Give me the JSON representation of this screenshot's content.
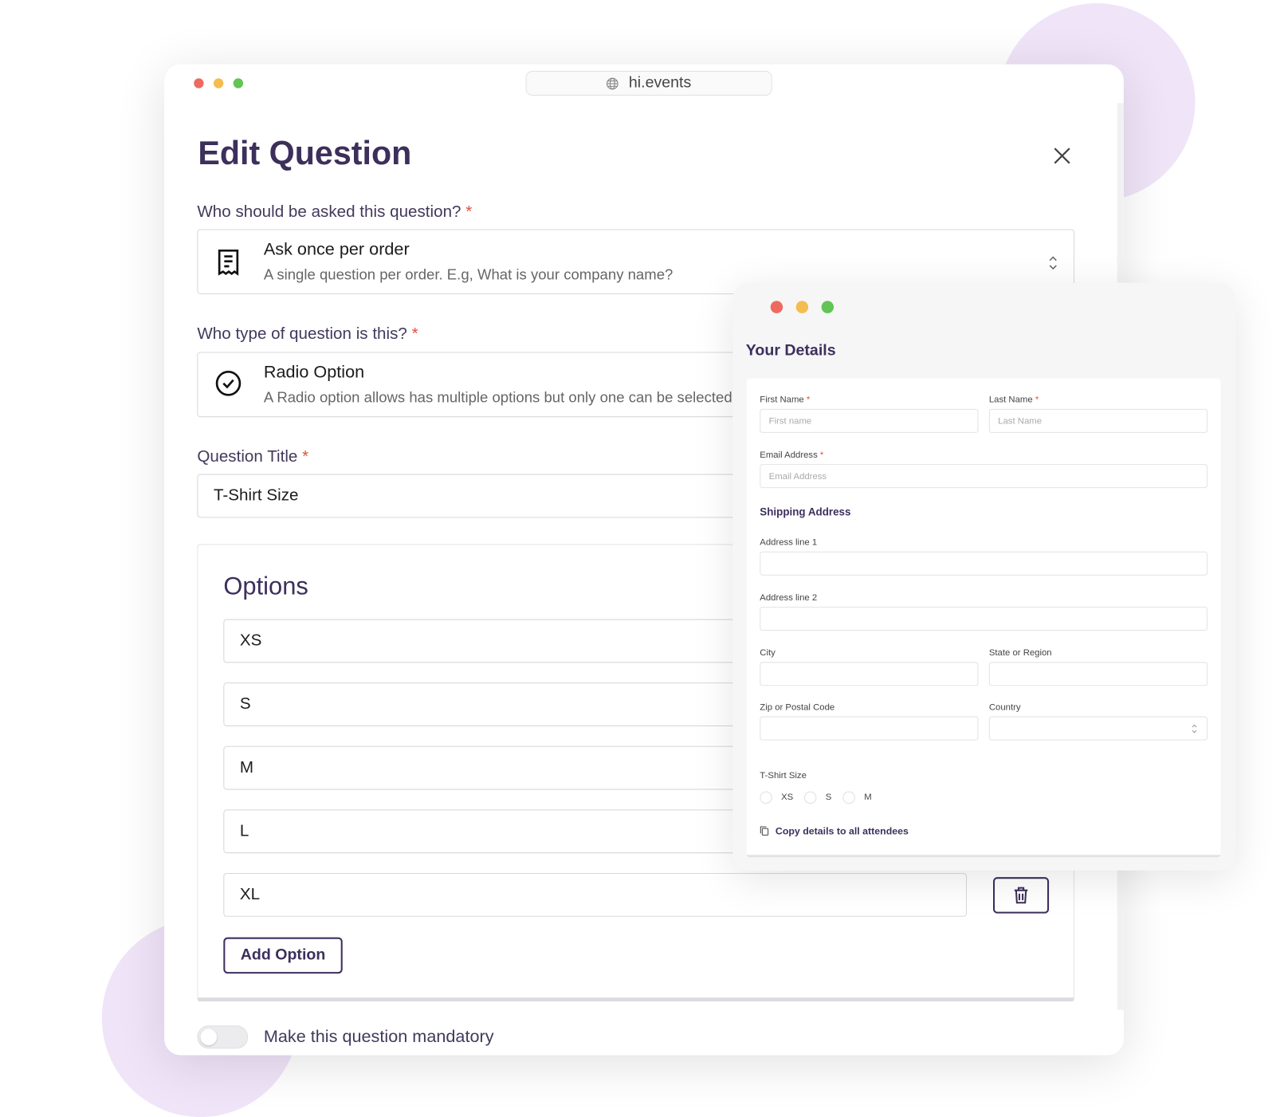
{
  "browser": {
    "url": "hi.events"
  },
  "editor": {
    "title": "Edit Question",
    "audience": {
      "label": "Who should be asked this question?",
      "required": "*",
      "selected_title": "Ask once per order",
      "selected_desc": "A single question per order. E.g, What is your company name?",
      "icon": "receipt-icon"
    },
    "type": {
      "label": "Who type of question is this?",
      "required": "*",
      "selected_title": "Radio Option",
      "selected_desc": "A Radio option allows has multiple options but only one can be selected.",
      "icon": "check-circle-icon"
    },
    "question_title": {
      "label": "Question Title",
      "required": "*",
      "value": "T-Shirt Size"
    },
    "options": {
      "heading": "Options",
      "items": [
        "XS",
        "S",
        "M",
        "L",
        "XL"
      ],
      "add_label": "Add Option"
    },
    "mandatory": {
      "label": "Make this question mandatory",
      "on": false
    }
  },
  "preview": {
    "title": "Your Details",
    "first_name": {
      "label": "First Name",
      "required": "*",
      "placeholder": "First name"
    },
    "last_name": {
      "label": "Last Name",
      "required": "*",
      "placeholder": "Last Name"
    },
    "email": {
      "label": "Email Address",
      "required": "*",
      "placeholder": "Email Address"
    },
    "shipping_heading": "Shipping Address",
    "address1": {
      "label": "Address line 1"
    },
    "address2": {
      "label": "Address line 2"
    },
    "city": {
      "label": "City"
    },
    "state": {
      "label": "State or Region"
    },
    "zip": {
      "label": "Zip or Postal Code"
    },
    "country": {
      "label": "Country"
    },
    "tshirt": {
      "label": "T-Shirt Size",
      "options": [
        "XS",
        "S",
        "M"
      ]
    },
    "copy_label": "Copy details to all attendees"
  },
  "colors": {
    "accent": "#3d2f5c",
    "required": "#e0503a",
    "blob": "#f0e4f9"
  }
}
